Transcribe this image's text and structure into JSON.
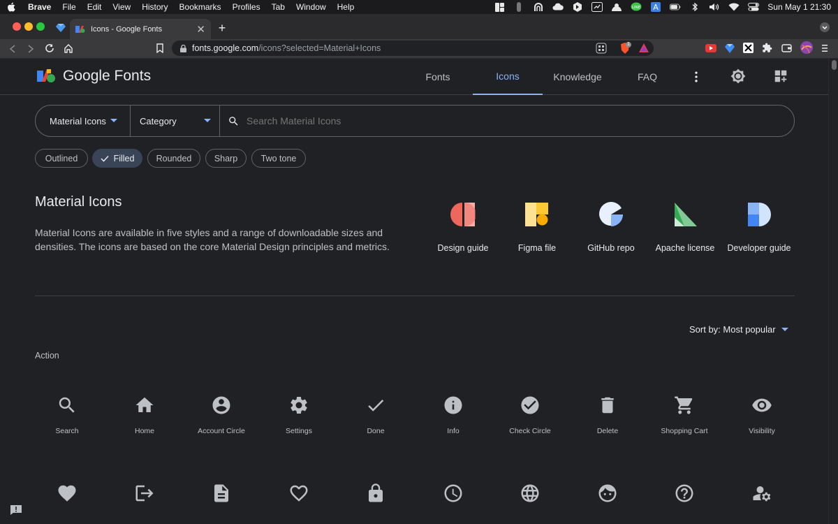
{
  "menubar": {
    "app": "Brave",
    "items": [
      "File",
      "Edit",
      "View",
      "History",
      "Bookmarks",
      "Profiles",
      "Tab",
      "Window",
      "Help"
    ],
    "clock": "Sun May 1  21:30"
  },
  "browser": {
    "tab_title": "Icons - Google Fonts",
    "url_host": "fonts.google.com",
    "url_path": "/icons?selected=Material+Icons",
    "shield_badge": "1"
  },
  "header": {
    "brand": "Google Fonts",
    "nav": [
      "Fonts",
      "Icons",
      "Knowledge",
      "FAQ"
    ],
    "active_nav": "Icons"
  },
  "search": {
    "family_select": "Material Icons",
    "category_select": "Category",
    "placeholder": "Search Material Icons"
  },
  "styles": {
    "chips": [
      "Outlined",
      "Filled",
      "Rounded",
      "Sharp",
      "Two tone"
    ],
    "selected": "Filled"
  },
  "intro": {
    "title": "Material Icons",
    "description": "Material Icons are available in five styles and a range of downloadable sizes and densities. The icons are based on the core Material Design principles and metrics."
  },
  "resources": [
    {
      "label": "Design guide",
      "icon": "design-guide-icon"
    },
    {
      "label": "Figma file",
      "icon": "figma-file-icon"
    },
    {
      "label": "GitHub repo",
      "icon": "github-repo-icon"
    },
    {
      "label": "Apache license",
      "icon": "apache-license-icon"
    },
    {
      "label": "Developer guide",
      "icon": "developer-guide-icon"
    }
  ],
  "sort": {
    "label": "Sort by: Most popular"
  },
  "section": {
    "label": "Action"
  },
  "icons_row1": [
    {
      "label": "Search",
      "icon": "search-icon"
    },
    {
      "label": "Home",
      "icon": "home-icon"
    },
    {
      "label": "Account Circle",
      "icon": "account-circle-icon"
    },
    {
      "label": "Settings",
      "icon": "settings-icon"
    },
    {
      "label": "Done",
      "icon": "done-icon"
    },
    {
      "label": "Info",
      "icon": "info-icon"
    },
    {
      "label": "Check Circle",
      "icon": "check-circle-icon"
    },
    {
      "label": "Delete",
      "icon": "delete-icon"
    },
    {
      "label": "Shopping Cart",
      "icon": "shopping-cart-icon"
    },
    {
      "label": "Visibility",
      "icon": "visibility-icon"
    }
  ],
  "icons_row2": [
    {
      "icon": "favorite-icon"
    },
    {
      "icon": "logout-icon"
    },
    {
      "icon": "description-icon"
    },
    {
      "icon": "favorite-border-icon"
    },
    {
      "icon": "lock-icon"
    },
    {
      "icon": "schedule-icon"
    },
    {
      "icon": "language-icon"
    },
    {
      "icon": "face-icon"
    },
    {
      "icon": "help-outline-icon"
    },
    {
      "icon": "manage-accounts-icon"
    }
  ],
  "colors": {
    "background": "#202124",
    "accent": "#8ab4f8",
    "icon_gray": "#bdc1c6",
    "chip_selected": "#394457"
  }
}
